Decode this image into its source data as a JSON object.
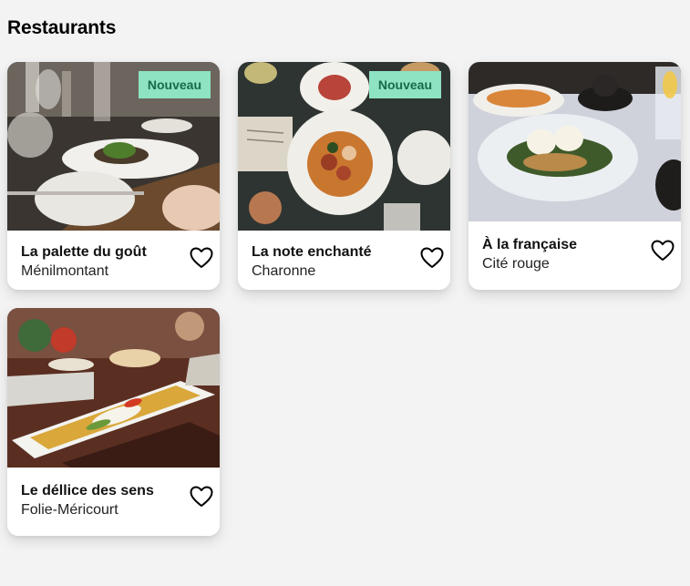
{
  "page": {
    "title": "Restaurants"
  },
  "restaurants": [
    {
      "name": "La palette du goût",
      "area": "Ménilmontant",
      "badge": "Nouveau",
      "favorite": false
    },
    {
      "name": "La note enchanté",
      "area": "Charonne",
      "badge": "Nouveau",
      "favorite": false
    },
    {
      "name": "À la française",
      "area": "Cité rouge",
      "badge": "",
      "favorite": false
    },
    {
      "name": "Le déllice des sens",
      "area": "Folie-Méricourt",
      "badge": "",
      "favorite": false
    }
  ],
  "icons": {
    "favorite": "heart-outline-icon"
  },
  "colors": {
    "background": "#f3f3f3",
    "badge_bg": "#8ee3c3",
    "badge_text": "#176b4b",
    "card_bg": "#ffffff"
  }
}
